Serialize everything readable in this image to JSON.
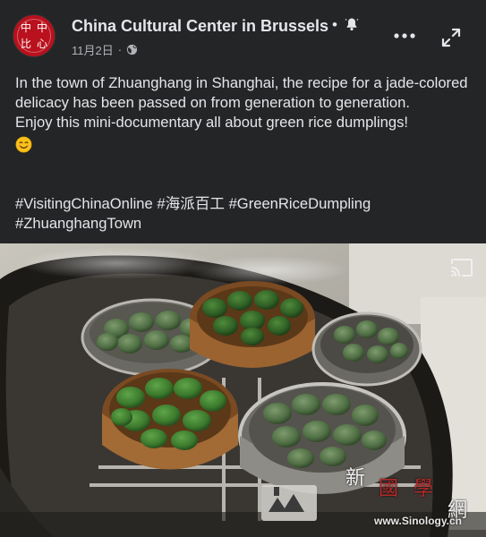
{
  "post": {
    "page_name": "China Cultural Center in Brussels",
    "name_suffix": "•",
    "date": "11月2日",
    "date_separator": "·",
    "body_line1": "In the town of Zhuanghang in Shanghai, the recipe for a jade-colored delicacy has been passed on from generation to generation.",
    "body_line2": "Enjoy this mini-documentary all about green rice dumplings!",
    "hashtags": "#VisitingChinaOnline #海派百工  #GreenRiceDumpling #ZhuanghangTown"
  },
  "avatar": {
    "glyphs": [
      "中",
      "中",
      "比",
      "心"
    ]
  },
  "icons": {
    "bell": "bell-icon",
    "globe": "globe-icon",
    "more": "more-horizontal-icon",
    "expand": "expand-icon",
    "cast": "cast-icon",
    "emoji": "smiling-face-emoji"
  },
  "watermark": {
    "chars": [
      "新",
      "國",
      "學",
      "網"
    ],
    "site": "www.Sinology.cn"
  },
  "colors": {
    "background": "#242526",
    "text": "#e4e6eb",
    "secondary_text": "#b0b3b8",
    "avatar_red": "#b9111d"
  }
}
